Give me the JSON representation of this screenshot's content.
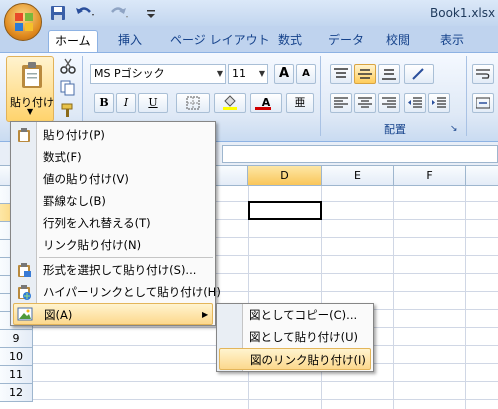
{
  "window": {
    "title": "Book1.xlsx -"
  },
  "ribbon": {
    "tabs": [
      "ホーム",
      "挿入",
      "ページ レイアウト",
      "数式",
      "データ",
      "校閲",
      "表示"
    ],
    "active_tab": "ホーム",
    "paste_label": "貼り付け",
    "font": {
      "name": "MS Pゴシック",
      "size": "11"
    },
    "buttons": {
      "bold": "B",
      "italic": "I",
      "underline": "U",
      "grow": "A",
      "shrink": "A",
      "font_color": "A",
      "phonetic": "亜"
    },
    "group_labels": {
      "alignment": "配置"
    },
    "colors": {
      "font_color": "#d00000",
      "fill_color": "#ffff00",
      "accent": "#15428b"
    }
  },
  "sheet": {
    "columns": [
      "D",
      "E",
      "F"
    ],
    "selected_column": "D",
    "rows": [
      "9",
      "10",
      "11",
      "12"
    ]
  },
  "paste_menu": {
    "items": [
      {
        "label": "貼り付け(P)",
        "icon": "paste-icon"
      },
      {
        "label": "数式(F)",
        "icon": ""
      },
      {
        "label": "値の貼り付け(V)",
        "icon": ""
      },
      {
        "label": "罫線なし(B)",
        "icon": ""
      },
      {
        "label": "行列を入れ替える(T)",
        "icon": ""
      },
      {
        "label": "リンク貼り付け(N)",
        "icon": ""
      },
      {
        "label": "形式を選択して貼り付け(S)...",
        "icon": "paste-special-icon"
      },
      {
        "label": "ハイパーリンクとして貼り付け(H)",
        "icon": "hyperlink-paste-icon"
      },
      {
        "label": "図(A)",
        "icon": "picture-icon",
        "highlighted": true,
        "has_submenu": true
      }
    ]
  },
  "picture_submenu": {
    "items": [
      {
        "label": "図としてコピー(C)..."
      },
      {
        "label": "図として貼り付け(U)"
      },
      {
        "label": "図のリンク貼り付け(I)",
        "highlighted": true
      }
    ]
  }
}
